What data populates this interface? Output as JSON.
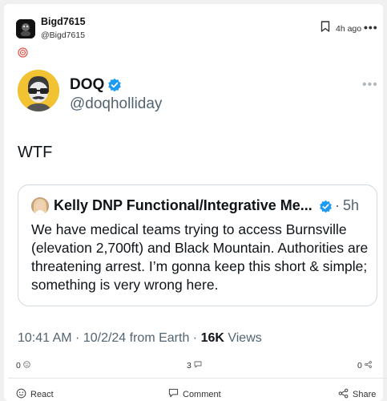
{
  "post": {
    "author_name": "Bigd7615",
    "author_handle": "@Bigd7615",
    "time": "4h ago",
    "more": "•••"
  },
  "tweet": {
    "name": "DOQ",
    "handle": "@doqholliday",
    "more": "•••",
    "text": "WTF",
    "quote": {
      "name": "Kelly DNP Functional/Integrative Me...",
      "dot": "·",
      "time": "5h",
      "body": "We have medical teams trying to access Burnsville (elevation 2,700ft) and Black Mountain. Authorities are threatening arrest. I’m gonna keep this short & simple; something is very wrong here."
    },
    "meta": {
      "timestamp": "10:41 AM · 10/2/24 from Earth · ",
      "views_count": "16K",
      "views_label": " Views"
    }
  },
  "counts": {
    "reactions": "0",
    "comments": "3",
    "shares": "0"
  },
  "actions": {
    "react": "React",
    "comment": "Comment",
    "share": "Share"
  },
  "colors": {
    "verified_blue": "#1d9bf0",
    "muted": "#536471"
  }
}
